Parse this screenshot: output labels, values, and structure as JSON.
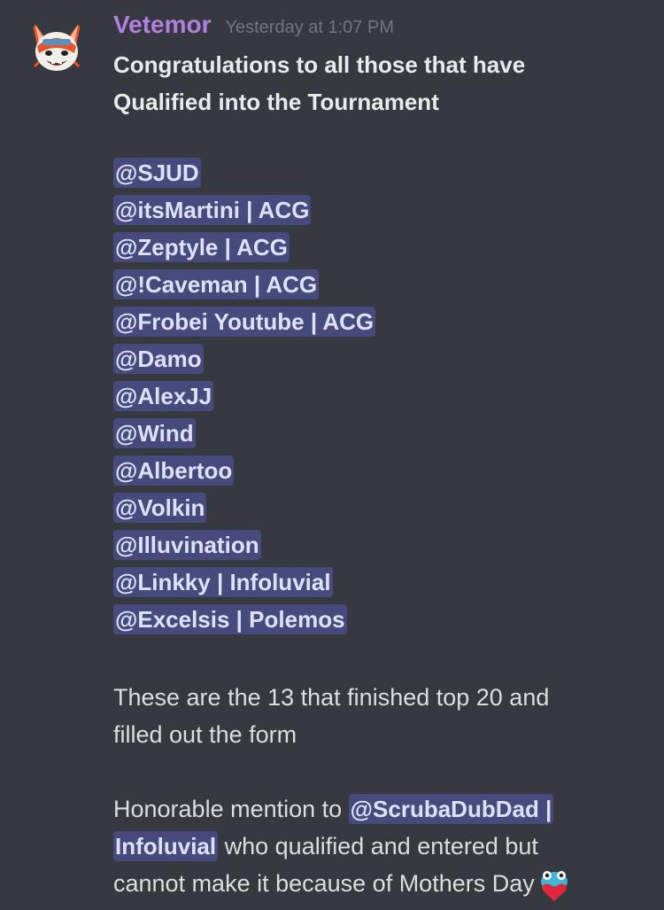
{
  "author": {
    "username": "Vetemor",
    "timestamp": "Yesterday at 1:07 PM",
    "avatar_icon": "fox-mascot-avatar"
  },
  "message": {
    "heading_line1": "Congratulations to all those that have",
    "heading_line2": "Qualified into the Tournament",
    "mentions": [
      "@SJUD",
      "@itsMartini | ACG",
      "@Zeptyle | ACG",
      "@!Caveman | ACG",
      "@Frobei Youtube | ACG",
      "@Damo",
      "@AlexJJ",
      "@Wind",
      "@Albertoo",
      "@Volkin",
      "@Illuvination",
      "@Linkky | Infoluvial",
      "@Excelsis | Polemos"
    ],
    "summary_line1": "These are the 13 that finished top 20 and",
    "summary_line2": "filled out the form",
    "honorable_prefix": "Honorable mention to ",
    "honorable_mention_part1": "@ScrubaDubDad |",
    "honorable_mention_part2": "Infoluvial",
    "honorable_suffix1": " who qualified and entered but",
    "honorable_line3": "cannot make it because of Mothers Day",
    "emoji_name": "frog-heart-emoji"
  },
  "colors": {
    "background": "#36393f",
    "username": "#b07fe0",
    "mention_bg": "#474a7d",
    "mention_text": "#dde0ff",
    "timestamp": "#72767d"
  }
}
